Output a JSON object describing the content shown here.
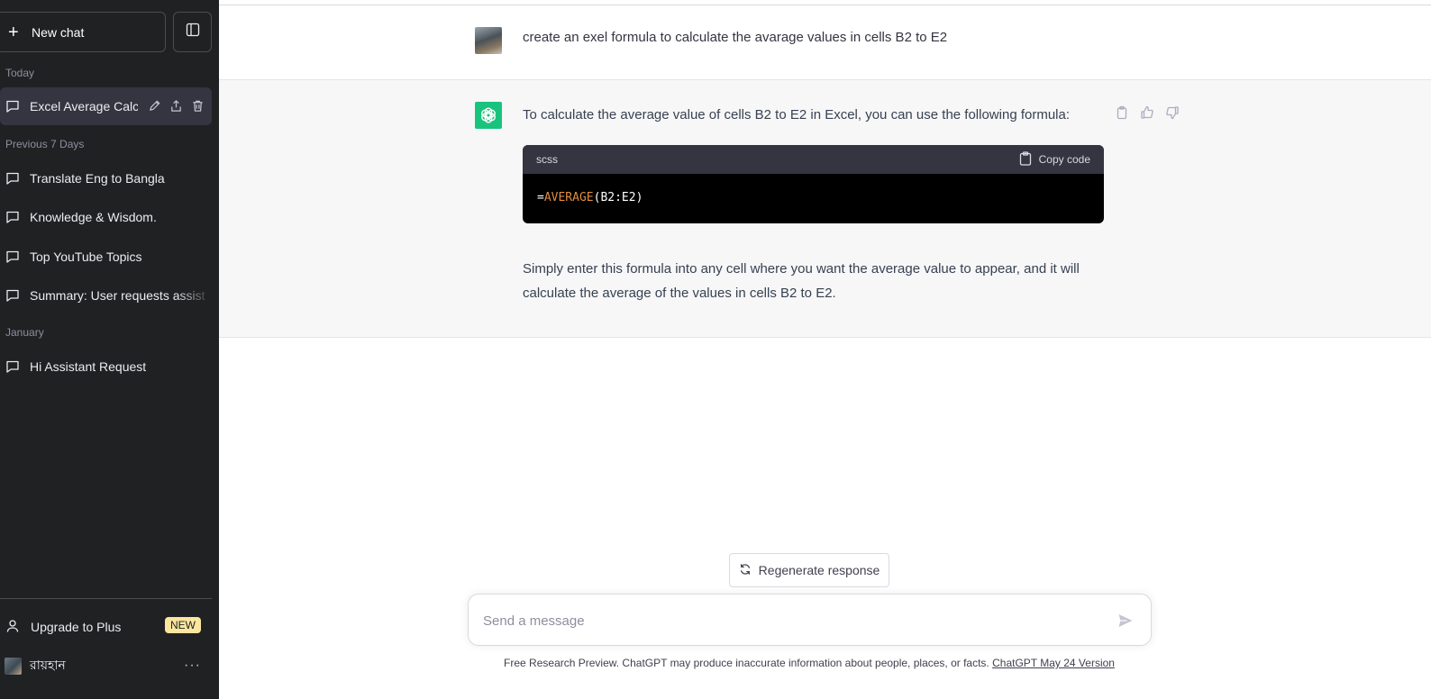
{
  "sidebar": {
    "new_chat_label": "New chat",
    "sections": {
      "today": "Today",
      "previous_7_days": "Previous 7 Days",
      "january": "January"
    },
    "items": [
      {
        "label": "Excel Average Calcul"
      },
      {
        "label": "Translate Eng to Bangla"
      },
      {
        "label": "Knowledge & Wisdom."
      },
      {
        "label": "Top YouTube Topics"
      },
      {
        "label": "Summary: User requests assist"
      },
      {
        "label": "Hi Assistant Request"
      }
    ],
    "upgrade_label": "Upgrade to Plus",
    "upgrade_badge": "NEW",
    "user_name": "রায়হান"
  },
  "conversation": {
    "user_message": "create an exel formula to calculate the avarage values in cells B2 to E2",
    "assistant_intro": "To calculate the average value of cells B2 to E2 in Excel, you can use the following formula:",
    "code": {
      "language": "scss",
      "copy_label": "Copy code",
      "prefix": "=",
      "function": "AVERAGE",
      "args": "(B2:E2)"
    },
    "assistant_outro": "Simply enter this formula into any cell where you want the average value to appear, and it will calculate the average of the values in cells B2 to E2."
  },
  "composer": {
    "regenerate_label": "Regenerate response",
    "placeholder": "Send a message"
  },
  "footer": {
    "text": "Free Research Preview. ChatGPT may produce inaccurate information about people, places, or facts. ",
    "link": "ChatGPT May 24 Version"
  },
  "colors": {
    "sidebar_bg": "#202123",
    "active_item_bg": "#343541",
    "assistant_avatar": "#19c37d",
    "badge_bg": "#fae69e",
    "code_function": "#df8d41"
  }
}
